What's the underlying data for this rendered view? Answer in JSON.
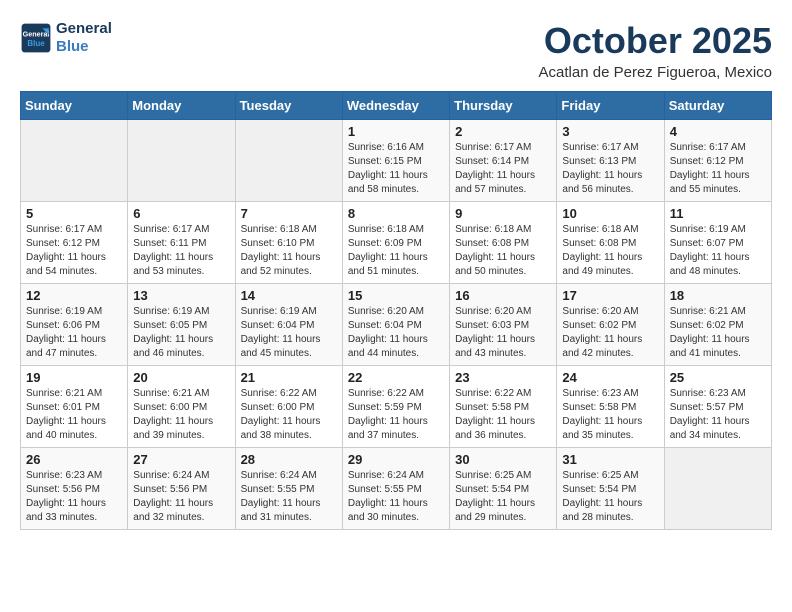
{
  "header": {
    "logo_line1": "General",
    "logo_line2": "Blue",
    "month": "October 2025",
    "location": "Acatlan de Perez Figueroa, Mexico"
  },
  "weekdays": [
    "Sunday",
    "Monday",
    "Tuesday",
    "Wednesday",
    "Thursday",
    "Friday",
    "Saturday"
  ],
  "weeks": [
    [
      {
        "day": "",
        "sunrise": "",
        "sunset": "",
        "daylight": ""
      },
      {
        "day": "",
        "sunrise": "",
        "sunset": "",
        "daylight": ""
      },
      {
        "day": "",
        "sunrise": "",
        "sunset": "",
        "daylight": ""
      },
      {
        "day": "1",
        "sunrise": "Sunrise: 6:16 AM",
        "sunset": "Sunset: 6:15 PM",
        "daylight": "Daylight: 11 hours and 58 minutes."
      },
      {
        "day": "2",
        "sunrise": "Sunrise: 6:17 AM",
        "sunset": "Sunset: 6:14 PM",
        "daylight": "Daylight: 11 hours and 57 minutes."
      },
      {
        "day": "3",
        "sunrise": "Sunrise: 6:17 AM",
        "sunset": "Sunset: 6:13 PM",
        "daylight": "Daylight: 11 hours and 56 minutes."
      },
      {
        "day": "4",
        "sunrise": "Sunrise: 6:17 AM",
        "sunset": "Sunset: 6:12 PM",
        "daylight": "Daylight: 11 hours and 55 minutes."
      }
    ],
    [
      {
        "day": "5",
        "sunrise": "Sunrise: 6:17 AM",
        "sunset": "Sunset: 6:12 PM",
        "daylight": "Daylight: 11 hours and 54 minutes."
      },
      {
        "day": "6",
        "sunrise": "Sunrise: 6:17 AM",
        "sunset": "Sunset: 6:11 PM",
        "daylight": "Daylight: 11 hours and 53 minutes."
      },
      {
        "day": "7",
        "sunrise": "Sunrise: 6:18 AM",
        "sunset": "Sunset: 6:10 PM",
        "daylight": "Daylight: 11 hours and 52 minutes."
      },
      {
        "day": "8",
        "sunrise": "Sunrise: 6:18 AM",
        "sunset": "Sunset: 6:09 PM",
        "daylight": "Daylight: 11 hours and 51 minutes."
      },
      {
        "day": "9",
        "sunrise": "Sunrise: 6:18 AM",
        "sunset": "Sunset: 6:08 PM",
        "daylight": "Daylight: 11 hours and 50 minutes."
      },
      {
        "day": "10",
        "sunrise": "Sunrise: 6:18 AM",
        "sunset": "Sunset: 6:08 PM",
        "daylight": "Daylight: 11 hours and 49 minutes."
      },
      {
        "day": "11",
        "sunrise": "Sunrise: 6:19 AM",
        "sunset": "Sunset: 6:07 PM",
        "daylight": "Daylight: 11 hours and 48 minutes."
      }
    ],
    [
      {
        "day": "12",
        "sunrise": "Sunrise: 6:19 AM",
        "sunset": "Sunset: 6:06 PM",
        "daylight": "Daylight: 11 hours and 47 minutes."
      },
      {
        "day": "13",
        "sunrise": "Sunrise: 6:19 AM",
        "sunset": "Sunset: 6:05 PM",
        "daylight": "Daylight: 11 hours and 46 minutes."
      },
      {
        "day": "14",
        "sunrise": "Sunrise: 6:19 AM",
        "sunset": "Sunset: 6:04 PM",
        "daylight": "Daylight: 11 hours and 45 minutes."
      },
      {
        "day": "15",
        "sunrise": "Sunrise: 6:20 AM",
        "sunset": "Sunset: 6:04 PM",
        "daylight": "Daylight: 11 hours and 44 minutes."
      },
      {
        "day": "16",
        "sunrise": "Sunrise: 6:20 AM",
        "sunset": "Sunset: 6:03 PM",
        "daylight": "Daylight: 11 hours and 43 minutes."
      },
      {
        "day": "17",
        "sunrise": "Sunrise: 6:20 AM",
        "sunset": "Sunset: 6:02 PM",
        "daylight": "Daylight: 11 hours and 42 minutes."
      },
      {
        "day": "18",
        "sunrise": "Sunrise: 6:21 AM",
        "sunset": "Sunset: 6:02 PM",
        "daylight": "Daylight: 11 hours and 41 minutes."
      }
    ],
    [
      {
        "day": "19",
        "sunrise": "Sunrise: 6:21 AM",
        "sunset": "Sunset: 6:01 PM",
        "daylight": "Daylight: 11 hours and 40 minutes."
      },
      {
        "day": "20",
        "sunrise": "Sunrise: 6:21 AM",
        "sunset": "Sunset: 6:00 PM",
        "daylight": "Daylight: 11 hours and 39 minutes."
      },
      {
        "day": "21",
        "sunrise": "Sunrise: 6:22 AM",
        "sunset": "Sunset: 6:00 PM",
        "daylight": "Daylight: 11 hours and 38 minutes."
      },
      {
        "day": "22",
        "sunrise": "Sunrise: 6:22 AM",
        "sunset": "Sunset: 5:59 PM",
        "daylight": "Daylight: 11 hours and 37 minutes."
      },
      {
        "day": "23",
        "sunrise": "Sunrise: 6:22 AM",
        "sunset": "Sunset: 5:58 PM",
        "daylight": "Daylight: 11 hours and 36 minutes."
      },
      {
        "day": "24",
        "sunrise": "Sunrise: 6:23 AM",
        "sunset": "Sunset: 5:58 PM",
        "daylight": "Daylight: 11 hours and 35 minutes."
      },
      {
        "day": "25",
        "sunrise": "Sunrise: 6:23 AM",
        "sunset": "Sunset: 5:57 PM",
        "daylight": "Daylight: 11 hours and 34 minutes."
      }
    ],
    [
      {
        "day": "26",
        "sunrise": "Sunrise: 6:23 AM",
        "sunset": "Sunset: 5:56 PM",
        "daylight": "Daylight: 11 hours and 33 minutes."
      },
      {
        "day": "27",
        "sunrise": "Sunrise: 6:24 AM",
        "sunset": "Sunset: 5:56 PM",
        "daylight": "Daylight: 11 hours and 32 minutes."
      },
      {
        "day": "28",
        "sunrise": "Sunrise: 6:24 AM",
        "sunset": "Sunset: 5:55 PM",
        "daylight": "Daylight: 11 hours and 31 minutes."
      },
      {
        "day": "29",
        "sunrise": "Sunrise: 6:24 AM",
        "sunset": "Sunset: 5:55 PM",
        "daylight": "Daylight: 11 hours and 30 minutes."
      },
      {
        "day": "30",
        "sunrise": "Sunrise: 6:25 AM",
        "sunset": "Sunset: 5:54 PM",
        "daylight": "Daylight: 11 hours and 29 minutes."
      },
      {
        "day": "31",
        "sunrise": "Sunrise: 6:25 AM",
        "sunset": "Sunset: 5:54 PM",
        "daylight": "Daylight: 11 hours and 28 minutes."
      },
      {
        "day": "",
        "sunrise": "",
        "sunset": "",
        "daylight": ""
      }
    ]
  ]
}
